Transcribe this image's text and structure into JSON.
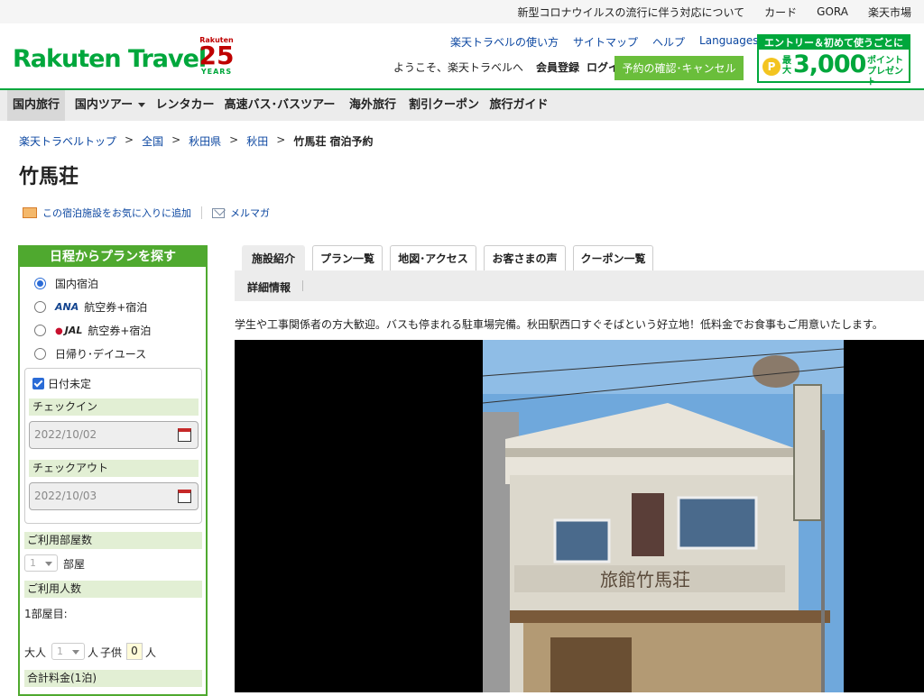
{
  "topbar": {
    "links": [
      "新型コロナウイルスの流行に伴う対応について",
      "カード",
      "GORA",
      "楽天市場"
    ]
  },
  "header": {
    "logo": "Rakuten Travel",
    "anniv_brand": "Rakuten",
    "anniv_number": "25",
    "anniv_years": "YEARS",
    "links": [
      "楽天トラベルの使い方",
      "サイトマップ",
      "ヘルプ"
    ],
    "languages": "Languages",
    "welcome": "ようこそ、楽天トラベルへ",
    "register": "会員登録",
    "login": "ログイン",
    "reservation_button": "予約の確認･キャンセル",
    "promo": {
      "banner": "エントリー＆初めて使うごとに",
      "coin": "P",
      "max": "最大",
      "amount": "3,000",
      "points_line1": "ポイント",
      "points_line2": "プレゼント"
    }
  },
  "nav": {
    "items": [
      "国内旅行",
      "国内ツアー",
      "レンタカー",
      "高速バス･バスツアー",
      "海外旅行",
      "割引クーポン",
      "旅行ガイド"
    ]
  },
  "breadcrumb": {
    "items": [
      "楽天トラベルトップ",
      "全国",
      "秋田県",
      "秋田"
    ],
    "current": "竹馬荘 宿泊予約",
    "separator": ">"
  },
  "hotel": {
    "name": "竹馬荘",
    "favorite_link": "この宿泊施設をお気に入りに追加",
    "mail_link": "メルマガ",
    "description": "学生や工事関係者の方大歓迎。バスも停まれる駐車場完備。秋田駅西口すぐそばという好立地！低料金でお食事もご用意いたします。"
  },
  "search": {
    "title": "日程からプランを探す",
    "options": {
      "domestic": "国内宿泊",
      "ana_brand": "ANA",
      "ana": "航空券+宿泊",
      "jal_brand": "JAL",
      "jal": "航空券+宿泊",
      "day": "日帰り･デイユース"
    },
    "date_undecided": "日付未定",
    "checkin_label": "チェックイン",
    "checkin_value": "2022/10/02",
    "checkout_label": "チェックアウト",
    "checkout_value": "2022/10/03",
    "rooms_label": "ご利用部屋数",
    "rooms_value": "1",
    "rooms_unit": "部屋",
    "guests_label": "ご利用人数",
    "room1": "1部屋目:",
    "adult_label": "大人",
    "adult_value": "1",
    "person_unit": "人",
    "child_label": "子供",
    "child_value": "0",
    "total_label": "合計料金(1泊)"
  },
  "tabs": {
    "items": [
      "施設紹介",
      "プラン一覧",
      "地図･アクセス",
      "お客さまの声",
      "クーポン一覧"
    ],
    "sub": "詳細情報"
  },
  "photo": {
    "sign_text": "旅館竹馬荘"
  },
  "colors": {
    "brand_green": "#00a73c",
    "link_blue": "#0c47a1",
    "button_green": "#6abe3b",
    "rakuten_red": "#bf0000"
  }
}
